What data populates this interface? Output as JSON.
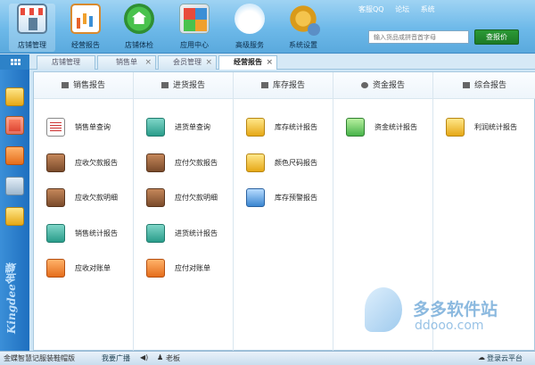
{
  "toolbar": {
    "buttons": [
      {
        "label": "店铺管理",
        "icon": "shop-icon"
      },
      {
        "label": "经营报告",
        "icon": "report-chart-icon"
      },
      {
        "label": "店铺体检",
        "icon": "health-check-icon"
      },
      {
        "label": "应用中心",
        "icon": "app-center-icon"
      },
      {
        "label": "高级服务",
        "icon": "cloud-service-icon"
      },
      {
        "label": "系统设置",
        "icon": "settings-gear-icon"
      }
    ],
    "links": [
      "客服QQ",
      "论坛",
      "系统"
    ],
    "search_placeholder": "输入货品或拼音首字母",
    "search_button": "查报价"
  },
  "tabs": [
    {
      "label": "店铺管理",
      "closable": false
    },
    {
      "label": "销售单",
      "closable": true
    },
    {
      "label": "会员管理",
      "closable": true
    },
    {
      "label": "经营报告",
      "closable": true,
      "active": true
    }
  ],
  "rail": {
    "icons": [
      "coins-icon",
      "notebook-icon",
      "calendar-icon",
      "camera-icon",
      "wallet-icon"
    ],
    "brand": "Kingdee金蝶"
  },
  "columns": [
    {
      "title": "销售报告",
      "items": [
        "销售单查询",
        "应收欠款报告",
        "应收欠款明细",
        "销售统计报告",
        "应收对账单"
      ]
    },
    {
      "title": "进货报告",
      "items": [
        "进货单查询",
        "应付欠款报告",
        "应付欠款明细",
        "进货统计报告",
        "应付对账单"
      ]
    },
    {
      "title": "库存报告",
      "items": [
        "库存统计报告",
        "颜色尺码报告",
        "库存预警报告"
      ]
    },
    {
      "title": "资金报告",
      "items": [
        "资金统计报告"
      ]
    },
    {
      "title": "综合报告",
      "items": [
        "利润统计报告"
      ]
    }
  ],
  "watermark": {
    "title": "多多软件站",
    "subtitle": "ddooo.com"
  },
  "status": {
    "product": "金蝶智慧记服装鞋帽版",
    "broadcast": "我要广播",
    "user": "老板",
    "login": "登录云平台"
  }
}
